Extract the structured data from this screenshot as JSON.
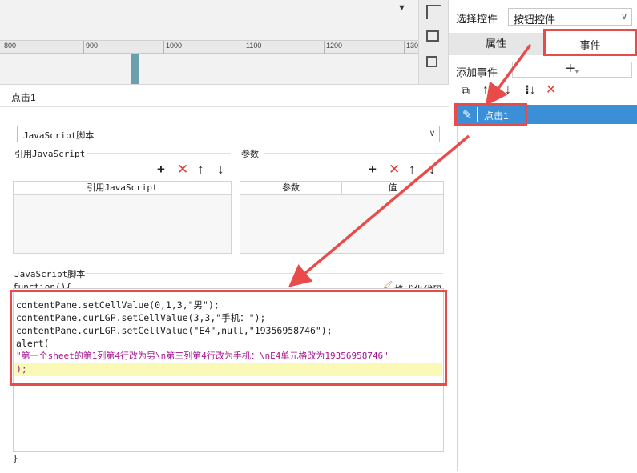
{
  "ruler": {
    "labels": [
      "800",
      "900",
      "1000",
      "1100",
      "1200",
      "130"
    ]
  },
  "right_panel": {
    "select_label": "选择控件",
    "select_value": "按钮控件",
    "tabs": {
      "attributes": "属性",
      "events": "事件"
    },
    "add_event_label": "添加事件",
    "add_event_plus": "+",
    "add_event_arrow": "▾",
    "event_item": "点击1"
  },
  "dialog": {
    "title": "点击1",
    "type_select_value": "JavaScript脚本",
    "ref_js_label": "引用JavaScript",
    "params_label": "参数",
    "ref_js_column": "引用JavaScript",
    "params_columns": [
      "参数",
      "值"
    ],
    "script_label": "JavaScript脚本",
    "function_open": "function(){",
    "format_code": "格式化代码",
    "function_close": "}",
    "code_lines": [
      "contentPane.setCellValue(0,1,3,\"男\");",
      "contentPane.curLGP.setCellValue(3,3,\"手机：\");",
      "contentPane.curLGP.setCellValue(\"E4\",null,\"19356958746\");",
      "alert(",
      "\"第一个sheet的第1列第4行改为男\\n第三列第4行改为手机：\\nE4单元格改为19356958746\"",
      ");"
    ]
  },
  "colors": {
    "accent_red": "#e94b4b",
    "selected_row": "#3b8fd7",
    "code_string": "#a3158f",
    "code_keyword": "#2231b8",
    "current_line": "#fafab6"
  }
}
